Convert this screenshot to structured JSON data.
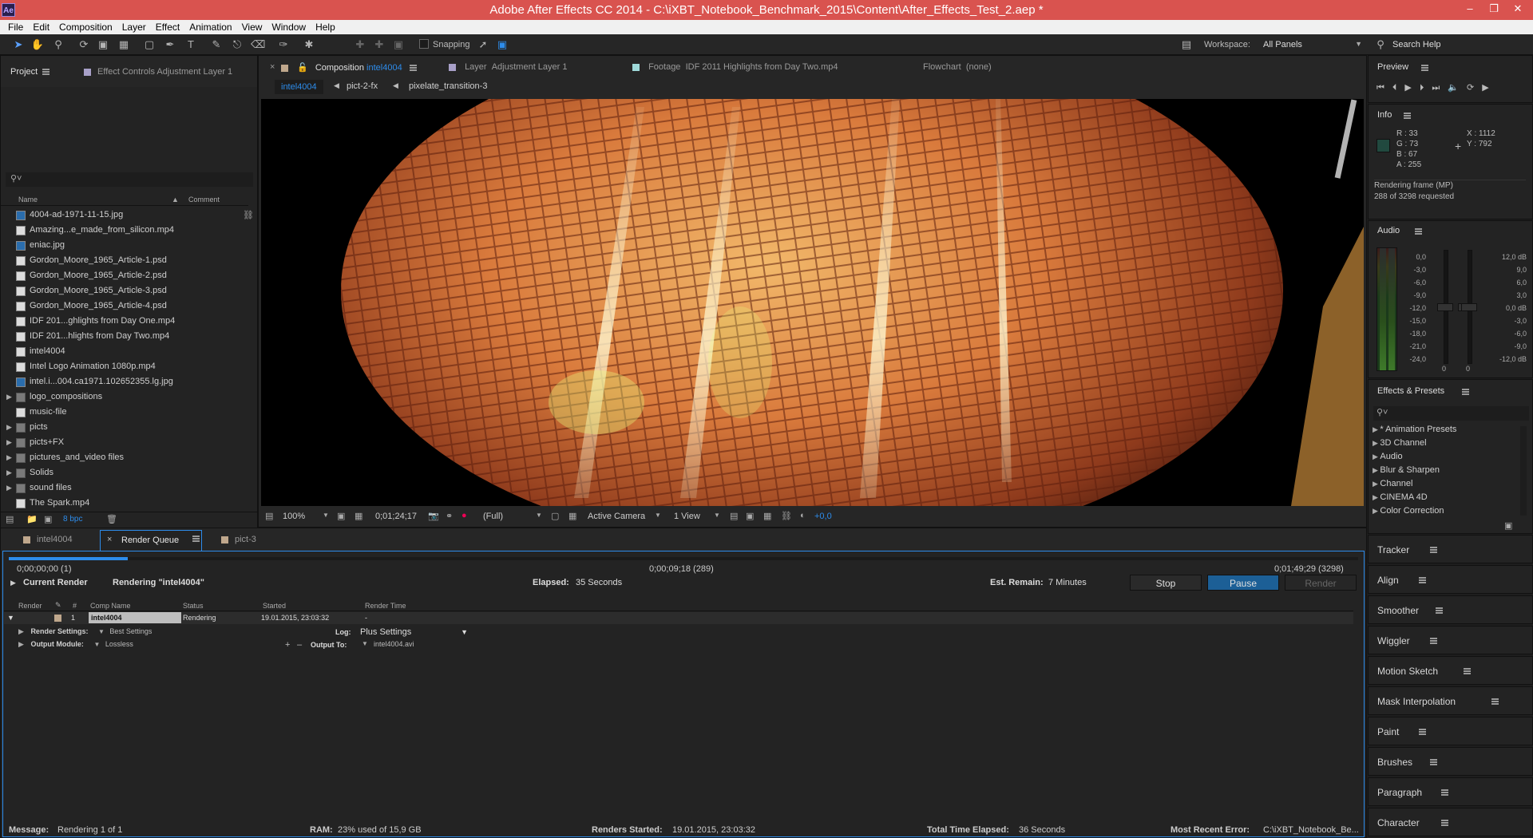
{
  "window": {
    "title": "Adobe After Effects CC 2014 - C:\\iXBT_Notebook_Benchmark_2015\\Content\\After_Effects_Test_2.aep *",
    "logo": "Ae"
  },
  "menu": [
    "File",
    "Edit",
    "Composition",
    "Layer",
    "Effect",
    "Animation",
    "View",
    "Window",
    "Help"
  ],
  "toolbar": {
    "snapping": "Snapping",
    "workspace_label": "Workspace:",
    "workspace_value": "All Panels",
    "search_help": "Search Help"
  },
  "project_panel": {
    "tab_project": "Project",
    "tab_effect_controls": "Effect Controls  Adjustment Layer 1",
    "col_name": "Name",
    "col_comment": "Comment",
    "bpc": "8 bpc",
    "items": [
      {
        "name": "4004-ad-1971-11-15.jpg",
        "type": "img"
      },
      {
        "name": "Amazing...e_made_from_silicon.mp4",
        "type": "file"
      },
      {
        "name": "eniac.jpg",
        "type": "img"
      },
      {
        "name": "Gordon_Moore_1965_Article-1.psd",
        "type": "file"
      },
      {
        "name": "Gordon_Moore_1965_Article-2.psd",
        "type": "file"
      },
      {
        "name": "Gordon_Moore_1965_Article-3.psd",
        "type": "file"
      },
      {
        "name": "Gordon_Moore_1965_Article-4.psd",
        "type": "file"
      },
      {
        "name": "IDF 201...ghlights from Day One.mp4",
        "type": "file"
      },
      {
        "name": "IDF 201...hlights from Day Two.mp4",
        "type": "file"
      },
      {
        "name": "intel4004",
        "type": "comp"
      },
      {
        "name": "Intel Logo Animation 1080p.mp4",
        "type": "file"
      },
      {
        "name": "intel.i...004.ca1971.102652355.lg.jpg",
        "type": "img"
      },
      {
        "name": "logo_compositions",
        "type": "folder"
      },
      {
        "name": "music-file",
        "type": "file"
      },
      {
        "name": "picts",
        "type": "folder"
      },
      {
        "name": "picts+FX",
        "type": "folder"
      },
      {
        "name": "pictures_and_video files",
        "type": "folder"
      },
      {
        "name": "Solids",
        "type": "folder"
      },
      {
        "name": "sound files",
        "type": "folder"
      },
      {
        "name": "The Spark.mp4",
        "type": "file"
      }
    ]
  },
  "viewer": {
    "tabs": [
      {
        "prefix": "Composition",
        "name": "intel4004"
      },
      {
        "prefix": "Layer",
        "name": "Adjustment Layer 1"
      },
      {
        "prefix": "Footage",
        "name": "IDF 2011 Highlights from Day Two.mp4"
      },
      {
        "prefix": "Flowchart",
        "name": "(none)"
      }
    ],
    "breadcrumbs": [
      "intel4004",
      "pict-2-fx",
      "pixelate_transition-3"
    ],
    "zoom": "100%",
    "timecode": "0;01;24;17",
    "resolution": "(Full)",
    "camera": "Active Camera",
    "view": "1 View",
    "exposure": "+0,0"
  },
  "render_queue": {
    "tabs": [
      "intel4004",
      "Render Queue",
      "pict-3"
    ],
    "time_start": "0;00;00;00 (1)",
    "time_mid": "0;00;09;18 (289)",
    "time_end": "0;01;49;29 (3298)",
    "progress": 0.088,
    "current_render_label": "Current Render",
    "rendering_text": "Rendering \"intel4004\"",
    "elapsed_label": "Elapsed:",
    "elapsed_value": "35 Seconds",
    "remain_label": "Est. Remain:",
    "remain_value": "7 Minutes",
    "btn_stop": "Stop",
    "btn_pause": "Pause",
    "btn_render": "Render",
    "cols": [
      "Render",
      "#",
      "Comp Name",
      "Status",
      "Started",
      "Render Time"
    ],
    "row": {
      "num": "1",
      "comp": "intel4004",
      "status": "Rendering",
      "started": "19.01.2015, 23:03:32",
      "time": "-"
    },
    "render_settings_label": "Render Settings:",
    "render_settings_value": "Best Settings",
    "log_label": "Log:",
    "log_value": "Plus Settings",
    "output_module_label": "Output Module:",
    "output_module_value": "Lossless",
    "output_to_label": "Output To:",
    "output_to_value": "intel4004.avi",
    "status_message_label": "Message:",
    "status_message": "Rendering 1 of 1",
    "ram_label": "RAM:",
    "ram": "23% used of 15,9 GB",
    "renders_started_label": "Renders Started:",
    "renders_started": "19.01.2015, 23:03:32",
    "total_elapsed_label": "Total Time Elapsed:",
    "total_elapsed": "36 Seconds",
    "recent_error_label": "Most Recent Error:",
    "recent_error": "C:\\iXBT_Notebook_Be..."
  },
  "preview": {
    "title": "Preview"
  },
  "info": {
    "title": "Info",
    "r": "R : 33",
    "g": "G : 73",
    "b": "B : 67",
    "a": "A :  255",
    "x": "X : 1112",
    "y": "Y : 792",
    "status1": "Rendering frame (MP)",
    "status2": "288 of 3298 requested",
    "color": "#21493f"
  },
  "audio": {
    "title": "Audio",
    "left_scale": [
      "0,0",
      "-3,0",
      "-6,0",
      "-9,0",
      "-12,0",
      "-15,0",
      "-18,0",
      "-21,0",
      "-24,0"
    ],
    "right_scale": [
      "12,0 dB",
      "9,0",
      "6,0",
      "3,0",
      "0,0 dB",
      "-3,0",
      "-6,0",
      "-9,0",
      "-12,0 dB"
    ],
    "slider_a": "0",
    "slider_b": "0"
  },
  "effects": {
    "title": "Effects & Presets",
    "items": [
      "* Animation Presets",
      "3D Channel",
      "Audio",
      "Blur & Sharpen",
      "Channel",
      "CINEMA 4D",
      "Color Correction"
    ]
  },
  "side_panels": [
    "Tracker",
    "Align",
    "Smoother",
    "Wiggler",
    "Motion Sketch",
    "Mask Interpolation",
    "Paint",
    "Brushes",
    "Paragraph",
    "Character"
  ],
  "colors": {
    "accent": "#2d8ceb",
    "title_bar": "#d9534f",
    "pause_btn": "#1c5f96"
  }
}
